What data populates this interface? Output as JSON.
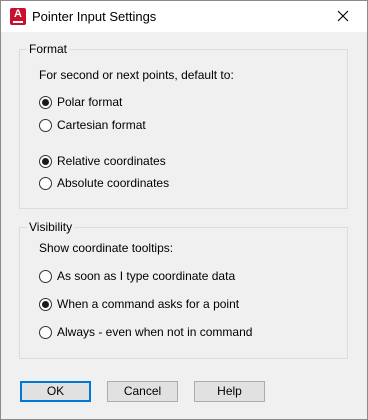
{
  "window": {
    "title": "Pointer Input Settings",
    "app_icon_letter": "A"
  },
  "format": {
    "label": "Format",
    "prompt": "For second or next points, default to:",
    "options_a": [
      {
        "label": "Polar format",
        "checked": true
      },
      {
        "label": "Cartesian format",
        "checked": false
      }
    ],
    "options_b": [
      {
        "label": "Relative coordinates",
        "checked": true
      },
      {
        "label": "Absolute coordinates",
        "checked": false
      }
    ]
  },
  "visibility": {
    "label": "Visibility",
    "prompt": "Show coordinate tooltips:",
    "options": [
      {
        "label": "As soon as I type coordinate data",
        "checked": false
      },
      {
        "label": "When a command asks for a point",
        "checked": true
      },
      {
        "label": "Always - even when not in command",
        "checked": false
      }
    ]
  },
  "buttons": {
    "ok": "OK",
    "cancel": "Cancel",
    "help": "Help"
  }
}
